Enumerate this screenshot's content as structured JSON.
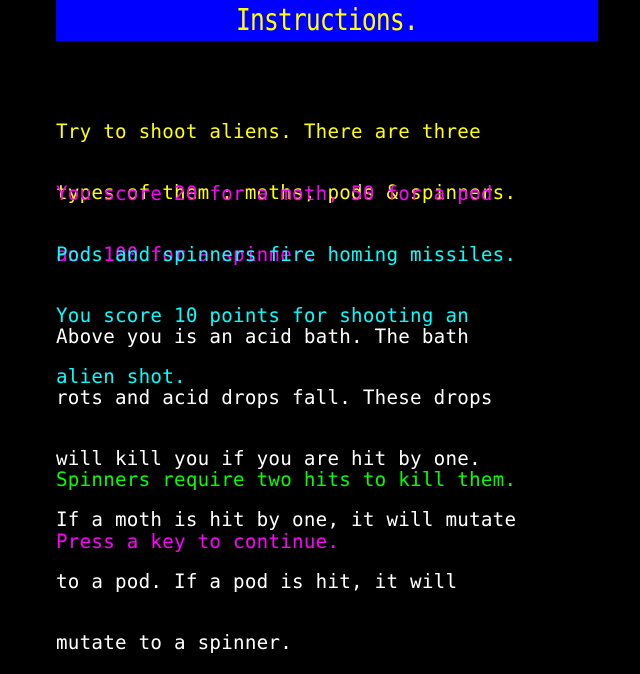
{
  "header": {
    "title": "Instructions.",
    "background_color": "#0000ff",
    "title_color": "#ffff00"
  },
  "paragraphs": [
    {
      "id": "intro",
      "color": "#ffff00",
      "lines": [
        "Try to shoot aliens. There are three",
        "types of them : moths, pods & spinners."
      ]
    },
    {
      "id": "scoring",
      "color": "#ff00ff",
      "lines": [
        "You score 20 for a moth, 50 for a pod",
        "and 100 for a spinner."
      ]
    },
    {
      "id": "missiles",
      "color": "#00ffff",
      "lines": [
        "Pods and spinners fire homing missiles.",
        "You score 10 points for shooting an",
        "alien shot."
      ]
    },
    {
      "id": "acid-bath",
      "color": "#ffffff",
      "lines": [
        "Above you is an acid bath. The bath",
        "rots and acid drops fall. These drops",
        "will kill you if you are hit by one.",
        "If a moth is hit by one, it will mutate",
        "to a pod. If a pod is hit, it will",
        "mutate to a spinner."
      ]
    },
    {
      "id": "spinners",
      "color": "#00ff00",
      "lines": [
        "Spinners require two hits to kill them."
      ]
    }
  ],
  "prompt": {
    "text": "Press a key to continue.",
    "color": "#ff00ff"
  },
  "scores": {
    "moth": 20,
    "pod": 50,
    "spinner": 100,
    "alien_shot": 10
  }
}
